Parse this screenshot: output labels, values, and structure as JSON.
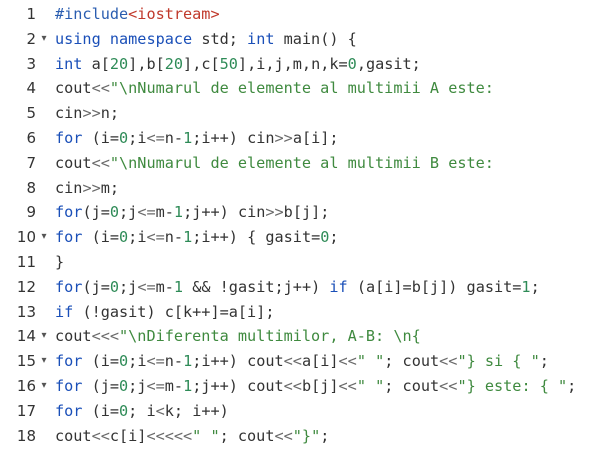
{
  "editor": {
    "lines": [
      {
        "num": "1",
        "fold": false,
        "tokens": [
          [
            "pre",
            "#include"
          ],
          [
            "inc",
            "<iostream>"
          ]
        ]
      },
      {
        "num": "2",
        "fold": true,
        "tokens": [
          [
            "kw",
            "using"
          ],
          [
            "plain",
            " "
          ],
          [
            "kw",
            "namespace"
          ],
          [
            "plain",
            " std; "
          ],
          [
            "kw",
            "int"
          ],
          [
            "plain",
            " main() {"
          ]
        ]
      },
      {
        "num": "3",
        "fold": false,
        "tokens": [
          [
            "kw",
            "int"
          ],
          [
            "plain",
            " a["
          ],
          [
            "num",
            "20"
          ],
          [
            "plain",
            "],b["
          ],
          [
            "num",
            "20"
          ],
          [
            "plain",
            "],c["
          ],
          [
            "num",
            "50"
          ],
          [
            "plain",
            "],i,j,m,n,k="
          ],
          [
            "num",
            "0"
          ],
          [
            "plain",
            ",gasit;"
          ]
        ]
      },
      {
        "num": "4",
        "fold": false,
        "tokens": [
          [
            "plain",
            "cout"
          ],
          [
            "op",
            "<<"
          ],
          [
            "str",
            "\"\\nNumarul de elemente al multimii A este:"
          ]
        ]
      },
      {
        "num": "5",
        "fold": false,
        "tokens": [
          [
            "plain",
            "cin"
          ],
          [
            "op",
            ">>"
          ],
          [
            "plain",
            "n;"
          ]
        ]
      },
      {
        "num": "6",
        "fold": false,
        "tokens": [
          [
            "kw",
            "for"
          ],
          [
            "plain",
            " (i="
          ],
          [
            "num",
            "0"
          ],
          [
            "plain",
            ";i"
          ],
          [
            "op",
            "<="
          ],
          [
            "plain",
            "n-"
          ],
          [
            "num",
            "1"
          ],
          [
            "plain",
            ";i++) cin"
          ],
          [
            "op",
            ">>"
          ],
          [
            "plain",
            "a[i];"
          ]
        ]
      },
      {
        "num": "7",
        "fold": false,
        "tokens": [
          [
            "plain",
            "cout"
          ],
          [
            "op",
            "<<"
          ],
          [
            "str",
            "\"\\nNumarul de elemente al multimii B este:"
          ]
        ]
      },
      {
        "num": "8",
        "fold": false,
        "tokens": [
          [
            "plain",
            "cin"
          ],
          [
            "op",
            ">>"
          ],
          [
            "plain",
            "m;"
          ]
        ]
      },
      {
        "num": "9",
        "fold": false,
        "tokens": [
          [
            "kw",
            "for"
          ],
          [
            "plain",
            "(j="
          ],
          [
            "num",
            "0"
          ],
          [
            "plain",
            ";j"
          ],
          [
            "op",
            "<="
          ],
          [
            "plain",
            "m-"
          ],
          [
            "num",
            "1"
          ],
          [
            "plain",
            ";j++) cin"
          ],
          [
            "op",
            ">>"
          ],
          [
            "plain",
            "b[j];"
          ]
        ]
      },
      {
        "num": "10",
        "fold": true,
        "tokens": [
          [
            "kw",
            "for"
          ],
          [
            "plain",
            " (i="
          ],
          [
            "num",
            "0"
          ],
          [
            "plain",
            ";i"
          ],
          [
            "op",
            "<="
          ],
          [
            "plain",
            "n-"
          ],
          [
            "num",
            "1"
          ],
          [
            "plain",
            ";i++) { gasit="
          ],
          [
            "num",
            "0"
          ],
          [
            "plain",
            ";"
          ]
        ]
      },
      {
        "num": "11",
        "fold": false,
        "tokens": [
          [
            "plain",
            "}"
          ]
        ]
      },
      {
        "num": "12",
        "fold": false,
        "tokens": [
          [
            "kw",
            "for"
          ],
          [
            "plain",
            "(j="
          ],
          [
            "num",
            "0"
          ],
          [
            "plain",
            ";j"
          ],
          [
            "op",
            "<="
          ],
          [
            "plain",
            "m-"
          ],
          [
            "num",
            "1"
          ],
          [
            "plain",
            " && !gasit;j++) "
          ],
          [
            "kw",
            "if"
          ],
          [
            "plain",
            " (a[i]=b[j]) gasit="
          ],
          [
            "num",
            "1"
          ],
          [
            "plain",
            ";"
          ]
        ]
      },
      {
        "num": "13",
        "fold": false,
        "tokens": [
          [
            "kw",
            "if"
          ],
          [
            "plain",
            " (!gasit) c[k++]=a[i];"
          ]
        ]
      },
      {
        "num": "14",
        "fold": true,
        "tokens": [
          [
            "plain",
            "cout"
          ],
          [
            "op",
            "<<<"
          ],
          [
            "str",
            "\"\\nDiferenta multimilor, A-B: \\n{"
          ]
        ]
      },
      {
        "num": "15",
        "fold": true,
        "tokens": [
          [
            "kw",
            "for"
          ],
          [
            "plain",
            " (i="
          ],
          [
            "num",
            "0"
          ],
          [
            "plain",
            ";i"
          ],
          [
            "op",
            "<="
          ],
          [
            "plain",
            "n-"
          ],
          [
            "num",
            "1"
          ],
          [
            "plain",
            ";i++) cout"
          ],
          [
            "op",
            "<<"
          ],
          [
            "plain",
            "a[i]"
          ],
          [
            "op",
            "<<"
          ],
          [
            "str",
            "\" \""
          ],
          [
            "plain",
            "; cout"
          ],
          [
            "op",
            "<<"
          ],
          [
            "str",
            "\"} si { \""
          ],
          [
            "plain",
            ";"
          ]
        ]
      },
      {
        "num": "16",
        "fold": true,
        "tokens": [
          [
            "kw",
            "for"
          ],
          [
            "plain",
            " (j="
          ],
          [
            "num",
            "0"
          ],
          [
            "plain",
            ";j"
          ],
          [
            "op",
            "<="
          ],
          [
            "plain",
            "m-"
          ],
          [
            "num",
            "1"
          ],
          [
            "plain",
            ";j++) cout"
          ],
          [
            "op",
            "<<"
          ],
          [
            "plain",
            "b[j]"
          ],
          [
            "op",
            "<<"
          ],
          [
            "str",
            "\" \""
          ],
          [
            "plain",
            "; cout"
          ],
          [
            "op",
            "<<"
          ],
          [
            "str",
            "\"} este: { \""
          ],
          [
            "plain",
            ";"
          ]
        ]
      },
      {
        "num": "17",
        "fold": false,
        "tokens": [
          [
            "kw",
            "for"
          ],
          [
            "plain",
            " (i="
          ],
          [
            "num",
            "0"
          ],
          [
            "plain",
            "; i"
          ],
          [
            "op",
            "<"
          ],
          [
            "plain",
            "k; i++)"
          ]
        ]
      },
      {
        "num": "18",
        "fold": false,
        "tokens": [
          [
            "plain",
            "cout"
          ],
          [
            "op",
            "<<"
          ],
          [
            "plain",
            "c[i]"
          ],
          [
            "op",
            "<<<<<"
          ],
          [
            "str",
            "\" \""
          ],
          [
            "plain",
            "; cout"
          ],
          [
            "op",
            "<<"
          ],
          [
            "str",
            "\"}\""
          ],
          [
            "plain",
            ";"
          ]
        ]
      }
    ],
    "fold_glyph": "▾"
  }
}
